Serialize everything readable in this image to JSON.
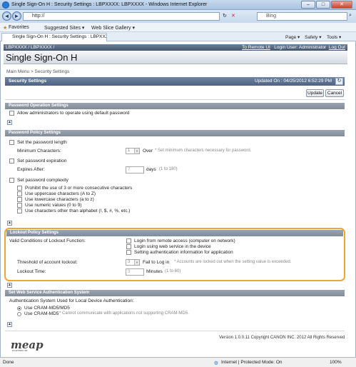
{
  "window": {
    "title": "Single Sign-On H : Security Settings : LBPXXXX: LBPXXXX - Windows Internet Explorer",
    "buttons": [
      "–",
      "□",
      "✕"
    ]
  },
  "address": {
    "url": "http://",
    "search_placeholder": "Bing"
  },
  "favorites": {
    "favorites_label": "Favorites",
    "suggested": "Suggested Sites ▾",
    "webslice": "Web Slice Gallery ▾"
  },
  "tab": {
    "label": "Single Sign-On H : Security Settings : LBPXXXX: L...",
    "commands": [
      "Page ▾",
      "Safety ▾",
      "Tools ▾"
    ]
  },
  "device": {
    "name": "LBPXXXX / LBPXXXX /",
    "to_remote": "To Remote UI",
    "login": "Login User: Administrator",
    "logout": "Log Out"
  },
  "app_title": "Single Sign-On H",
  "breadcrumb": "Main Menu > Security Settings",
  "section": {
    "title": "Security Settings",
    "updated": "Updated On : 04/25/2012 6:52:29 PM",
    "update_btn": "Update",
    "cancel_btn": "Cancel"
  },
  "password_operation": {
    "header": "Password Operation Settings",
    "allow_default": "Allow administrators to operate using default password"
  },
  "password_policy": {
    "header": "Password Policy Settings",
    "set_length": "Set the password length",
    "min_chars_label": "Minimum Characters:",
    "min_chars_value": "1",
    "over": "Over",
    "min_chars_note": "* Set minimum characters necessary for password.",
    "set_expiration": "Set password expiration",
    "expires_label": "Expires After:",
    "expires_value": "7",
    "days": "days",
    "days_range": "(1 to 180)",
    "set_complexity": "Set password complexity",
    "rules": [
      "Prohibit the use of 3 or more consecutive characters",
      "Use uppercase characters (A to Z)",
      "Use lowercase characters (a to z)",
      "Use numeric values (0 to 9)",
      "Use characters other than alphabet (!, $, #, %, etc.)"
    ]
  },
  "lockout": {
    "header": "Lockout Policy Settings",
    "valid_label": "Valid Conditions of Lockout Function:",
    "conditions": [
      "Login from remote access (computer on network)",
      "Login using web service in the device",
      "Setting authentication information for application"
    ],
    "threshold_label": "Threshold of account lockout:",
    "threshold_value": "3",
    "fail_to_log_in": "Fail to Log in",
    "threshold_note": "* Accounts are locked out when the setting value is exceeded.",
    "lockout_time_label": "Lockout Time:",
    "lockout_time_value": "3",
    "minutes": "Minutes",
    "minutes_range": "(1 to 60)"
  },
  "web_service": {
    "header": "Set Web Service Authentication System",
    "auth_label": "Authentication System Used for Local Device Authentication:",
    "options": [
      "Use CRAM-MD5/MD5",
      "Use CRAM-MD5"
    ],
    "md5_note": "* Cannot communicate with applications not supporting CRAM-MD5."
  },
  "footer": {
    "version": "Version 1.0.0.11 Copyright CANON INC. 2012 All Rights Reserved",
    "logo": "meap",
    "logo_sub": "POWERED BY"
  },
  "statusbar": {
    "done": "Done",
    "zone": "Internet | Protected Mode: On",
    "zoom": "100%"
  }
}
